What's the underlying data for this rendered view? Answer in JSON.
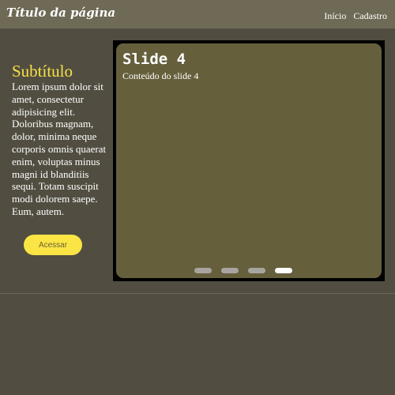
{
  "header": {
    "title": "Título da página",
    "nav": [
      {
        "label": "Início"
      },
      {
        "label": "Cadastro"
      }
    ]
  },
  "sidebar": {
    "subtitle": "Subtítulo",
    "text": "Lorem ipsum dolor sit amet, consectetur adipisicing elit. Doloribus magnam, dolor, minima neque corporis omnis quaerat enim, voluptas minus magni id blanditiis sequi. Totam suscipit modi dolorem saepe. Eum, autem.",
    "button_label": "Acessar"
  },
  "slider": {
    "current": {
      "title": "Slide 4",
      "content": "Conteúdo do slide 4"
    },
    "slide_count": 4,
    "active_index": 4
  },
  "colors": {
    "header_bg": "#6f6a56",
    "page_bg": "#514e41",
    "accent_yellow": "#fbe544",
    "slide_bg": "#655f3c"
  }
}
